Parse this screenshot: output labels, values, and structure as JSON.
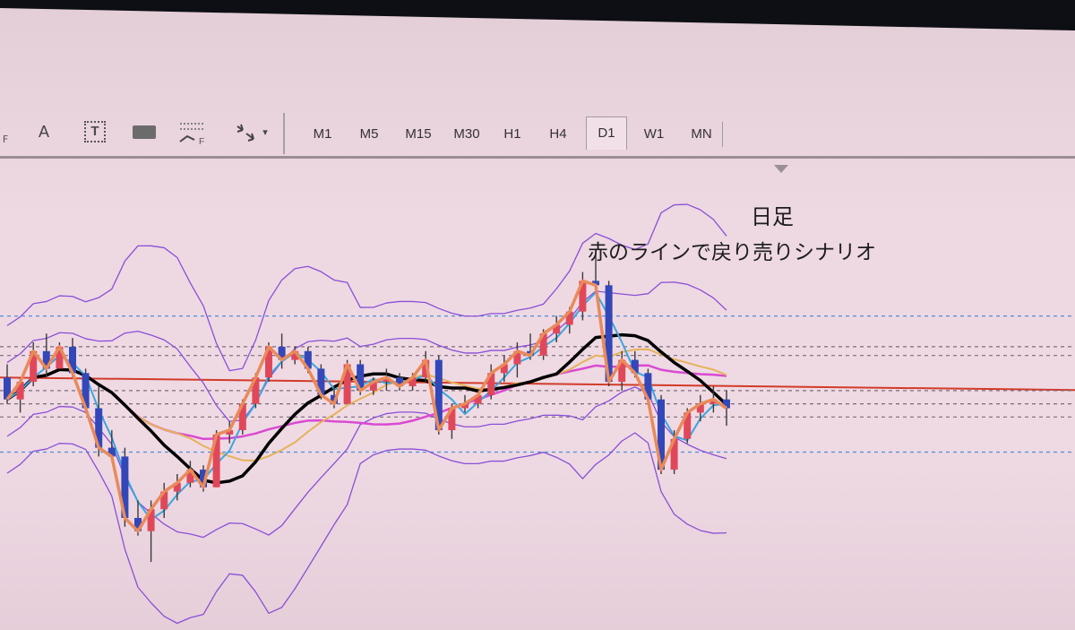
{
  "toolbar": {
    "tools": [
      {
        "name": "fibo-tool",
        "label": "F"
      },
      {
        "name": "text-tool",
        "label": "A"
      },
      {
        "name": "text-label-tool",
        "label": "T"
      },
      {
        "name": "rectangle-tool",
        "label": ""
      },
      {
        "name": "fibo-fan-tool",
        "label": "F"
      },
      {
        "name": "arrows-tool",
        "label": "▾"
      }
    ],
    "timeframes": [
      "M1",
      "M5",
      "M15",
      "M30",
      "H1",
      "H4",
      "D1",
      "W1",
      "MN"
    ],
    "active_timeframe": "D1"
  },
  "annotation": {
    "line1": "日足",
    "line2": "赤のラインで戻り売りシナリオ"
  },
  "colors": {
    "bull_candle": "#e0485a",
    "bear_candle": "#3347b8",
    "wick": "#3a3a3a",
    "ma_fast": "#3aa6e0",
    "ma_orange": "#e98a5a",
    "ma_gold": "#e6b25a",
    "ma_magenta": "#d94ad2",
    "ma_black": "#000000",
    "bollinger": "#8a4fd6",
    "red_line": "#d23b2a",
    "dashed_blue": "#4a8fd8",
    "dashed_dark": "#7a6a78"
  },
  "chart_data": {
    "type": "candlestick",
    "timeframe": "D1",
    "ylim": [
      0,
      100
    ],
    "candles": [
      {
        "o": 52,
        "h": 55,
        "l": 46,
        "c": 47
      },
      {
        "o": 47,
        "h": 52,
        "l": 44,
        "c": 51
      },
      {
        "o": 51,
        "h": 60,
        "l": 50,
        "c": 58
      },
      {
        "o": 58,
        "h": 62,
        "l": 52,
        "c": 54
      },
      {
        "o": 54,
        "h": 60,
        "l": 54,
        "c": 59
      },
      {
        "o": 59,
        "h": 61,
        "l": 52,
        "c": 53
      },
      {
        "o": 53,
        "h": 54,
        "l": 44,
        "c": 45
      },
      {
        "o": 45,
        "h": 50,
        "l": 34,
        "c": 36
      },
      {
        "o": 36,
        "h": 40,
        "l": 33,
        "c": 34
      },
      {
        "o": 34,
        "h": 36,
        "l": 18,
        "c": 20
      },
      {
        "o": 20,
        "h": 24,
        "l": 16,
        "c": 17
      },
      {
        "o": 17,
        "h": 24,
        "l": 10,
        "c": 22
      },
      {
        "o": 22,
        "h": 28,
        "l": 20,
        "c": 26
      },
      {
        "o": 26,
        "h": 30,
        "l": 24,
        "c": 28
      },
      {
        "o": 28,
        "h": 33,
        "l": 27,
        "c": 31
      },
      {
        "o": 31,
        "h": 32,
        "l": 26,
        "c": 27
      },
      {
        "o": 27,
        "h": 40,
        "l": 27,
        "c": 39
      },
      {
        "o": 39,
        "h": 42,
        "l": 37,
        "c": 40
      },
      {
        "o": 40,
        "h": 47,
        "l": 39,
        "c": 46
      },
      {
        "o": 46,
        "h": 53,
        "l": 45,
        "c": 52
      },
      {
        "o": 52,
        "h": 60,
        "l": 51,
        "c": 59
      },
      {
        "o": 59,
        "h": 62,
        "l": 54,
        "c": 56
      },
      {
        "o": 56,
        "h": 59,
        "l": 55,
        "c": 58
      },
      {
        "o": 58,
        "h": 59,
        "l": 53,
        "c": 54
      },
      {
        "o": 54,
        "h": 55,
        "l": 47,
        "c": 48
      },
      {
        "o": 48,
        "h": 50,
        "l": 45,
        "c": 46
      },
      {
        "o": 46,
        "h": 56,
        "l": 46,
        "c": 55
      },
      {
        "o": 55,
        "h": 56,
        "l": 48,
        "c": 49
      },
      {
        "o": 49,
        "h": 52,
        "l": 48,
        "c": 51
      },
      {
        "o": 51,
        "h": 54,
        "l": 49,
        "c": 52
      },
      {
        "o": 52,
        "h": 53,
        "l": 49,
        "c": 50
      },
      {
        "o": 50,
        "h": 53,
        "l": 49,
        "c": 52
      },
      {
        "o": 52,
        "h": 58,
        "l": 51,
        "c": 56
      },
      {
        "o": 56,
        "h": 57,
        "l": 39,
        "c": 40
      },
      {
        "o": 40,
        "h": 46,
        "l": 38,
        "c": 45
      },
      {
        "o": 45,
        "h": 48,
        "l": 44,
        "c": 46
      },
      {
        "o": 46,
        "h": 49,
        "l": 45,
        "c": 48
      },
      {
        "o": 48,
        "h": 55,
        "l": 47,
        "c": 53
      },
      {
        "o": 53,
        "h": 57,
        "l": 51,
        "c": 55
      },
      {
        "o": 55,
        "h": 60,
        "l": 52,
        "c": 58
      },
      {
        "o": 58,
        "h": 62,
        "l": 56,
        "c": 57
      },
      {
        "o": 57,
        "h": 63,
        "l": 56,
        "c": 62
      },
      {
        "o": 62,
        "h": 66,
        "l": 60,
        "c": 64
      },
      {
        "o": 64,
        "h": 68,
        "l": 62,
        "c": 67
      },
      {
        "o": 67,
        "h": 76,
        "l": 65,
        "c": 74
      },
      {
        "o": 74,
        "h": 80,
        "l": 72,
        "c": 73
      },
      {
        "o": 73,
        "h": 74,
        "l": 50,
        "c": 51
      },
      {
        "o": 51,
        "h": 58,
        "l": 49,
        "c": 56
      },
      {
        "o": 56,
        "h": 58,
        "l": 52,
        "c": 53
      },
      {
        "o": 53,
        "h": 54,
        "l": 46,
        "c": 47
      },
      {
        "o": 47,
        "h": 48,
        "l": 30,
        "c": 31
      },
      {
        "o": 31,
        "h": 40,
        "l": 30,
        "c": 38
      },
      {
        "o": 38,
        "h": 45,
        "l": 37,
        "c": 44
      },
      {
        "o": 44,
        "h": 48,
        "l": 42,
        "c": 46
      },
      {
        "o": 46,
        "h": 50,
        "l": 44,
        "c": 47
      },
      {
        "o": 47,
        "h": 49,
        "l": 41,
        "c": 45
      }
    ],
    "horizontal_lines": [
      {
        "style": "solid",
        "color": "red",
        "value": 52
      },
      {
        "style": "dashed",
        "color": "blue",
        "value": 66
      },
      {
        "style": "dashed",
        "color": "blue",
        "value": 35
      },
      {
        "style": "dashed",
        "color": "dark",
        "value": 59
      },
      {
        "style": "dashed",
        "color": "dark",
        "value": 57
      },
      {
        "style": "dashed",
        "color": "dark",
        "value": 49
      },
      {
        "style": "dashed",
        "color": "dark",
        "value": 46
      },
      {
        "style": "dashed",
        "color": "dark",
        "value": 43
      }
    ]
  }
}
